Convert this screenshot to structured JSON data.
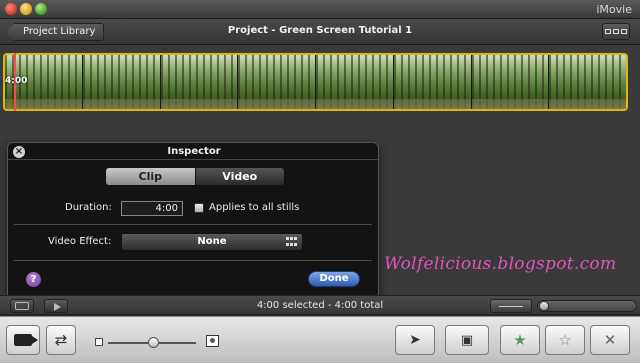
{
  "window": {
    "app_title": "iMovie"
  },
  "header": {
    "back_label": "Project Library",
    "project_title": "Project - Green Screen Tutorial 1",
    "layout_icon": "layout-toggle-icon"
  },
  "timeline": {
    "playhead_timecode": "4:00",
    "frame_count": 8,
    "accent": "#e3b40f"
  },
  "inspector": {
    "title": "Inspector",
    "tabs": [
      {
        "label": "Clip",
        "selected": true
      },
      {
        "label": "Video",
        "selected": false
      }
    ],
    "duration_label": "Duration:",
    "duration_value": "4:00",
    "applies_all_label": "Applies to all stills",
    "applies_all_checked": false,
    "video_effect_label": "Video Effect:",
    "video_effect_value": "None",
    "help_label": "?",
    "done_label": "Done",
    "close_icon": "close-icon"
  },
  "watermark": "Wolfelicious.blogspot.com",
  "playback": {
    "selection_info": "4:00 selected - 4:00 total"
  },
  "colors": {
    "done_button": "#2e5cb0",
    "help_button": "#6a3a9a",
    "watermark": "#e056b8",
    "star": "#5a9a5a"
  }
}
